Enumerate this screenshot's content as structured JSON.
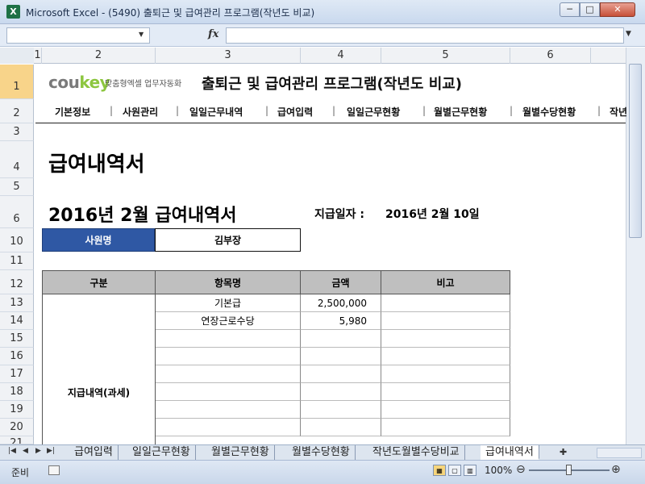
{
  "window": {
    "title": "Microsoft Excel - (5490) 출퇴근 및 급여관리 프로그램(작년도 비교)",
    "app_icon": "excel-icon",
    "min_label": "─",
    "max_label": "□",
    "close_label": "✕"
  },
  "formula_bar": {
    "fx_label": "fx",
    "name_box_value": "",
    "formula_value": ""
  },
  "columns": [
    "1",
    "2",
    "3",
    "4",
    "5",
    "6"
  ],
  "rows": [
    "1",
    "2",
    "3",
    "4",
    "5",
    "6",
    "10",
    "11",
    "12",
    "13",
    "14",
    "15",
    "16",
    "17",
    "18",
    "19",
    "20",
    "21"
  ],
  "brand": {
    "name_prefix": "cou",
    "name_suffix": "key",
    "tagline": "맞춤형엑셀 업무자동화"
  },
  "program_title": "출퇴근 및 급여관리 프로그램(작년도 비교)",
  "nav": [
    "기본정보",
    "사원관리",
    "일일근무내역",
    "급여입력",
    "일일근무현황",
    "월별근무현황",
    "월별수당현황",
    "작년"
  ],
  "nav_separator": "|",
  "sheet_title": "급여내역서",
  "slip_title": "2016년  2월  급여내역서",
  "pay_date_label": "지급일자 :",
  "pay_date": "2016년  2월  10일",
  "employee": {
    "label": "사원명",
    "name": "김부장"
  },
  "table": {
    "headers": [
      "구분",
      "항목명",
      "금액",
      "비고"
    ],
    "category": "지급내역(과세)",
    "rows": [
      {
        "item": "기본급",
        "amount": "2,500,000",
        "note": ""
      },
      {
        "item": "연장근로수당",
        "amount": "5,980",
        "note": ""
      },
      {
        "item": "",
        "amount": "",
        "note": ""
      },
      {
        "item": "",
        "amount": "",
        "note": ""
      },
      {
        "item": "",
        "amount": "",
        "note": ""
      },
      {
        "item": "",
        "amount": "",
        "note": ""
      },
      {
        "item": "",
        "amount": "",
        "note": ""
      },
      {
        "item": "",
        "amount": "",
        "note": ""
      }
    ]
  },
  "sheet_tabs": [
    "급여입력",
    "일일근무현황",
    "월별근무현황",
    "월별수당현황",
    "작년도월별수당비교",
    "급여내역서"
  ],
  "active_tab": "급여내역서",
  "status": {
    "ready": "준비",
    "zoom": "100%",
    "zoom_out": "⊖",
    "zoom_in": "⊕"
  }
}
